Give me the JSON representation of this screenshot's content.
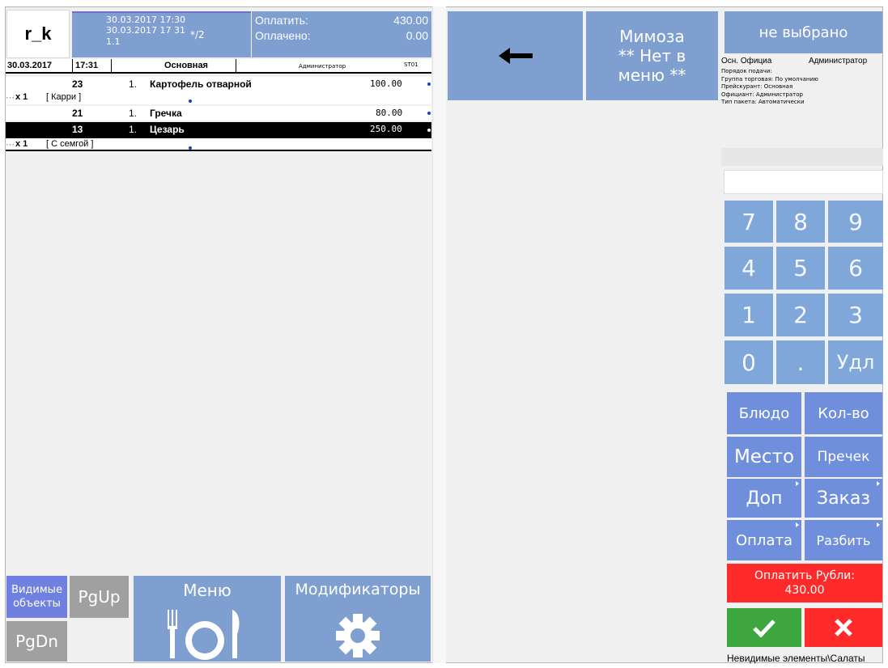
{
  "header": {
    "logo": "r_k",
    "datetime_open": "30.03.2017 17:30",
    "datetime_now": "30.03.2017 17 31",
    "table_no": "1.1",
    "guests": "*/2",
    "pay_label": "Оплатить:",
    "pay_value": "430.00",
    "paid_label": "Оплачено:",
    "paid_value": "0.00"
  },
  "order": {
    "date": "30.03.2017",
    "time": "17:31",
    "menu": "Основная",
    "waiter": "Администратор",
    "station": "ST01",
    "items": [
      {
        "code": "23",
        "qty": "1.",
        "name": "Картофель отварной",
        "price": "100.00",
        "modifier_qty": "x 1",
        "modifier": "[ Карри ]"
      },
      {
        "code": "21",
        "qty": "1.",
        "name": "Гречка",
        "price": "80.00"
      },
      {
        "code": "13",
        "qty": "1.",
        "name": "Цезарь",
        "price": "250.00",
        "modifier_qty": "x 1",
        "modifier": "[ С семгой ]"
      }
    ]
  },
  "left_buttons": {
    "visible_objects": "Видимые объекты",
    "pgup": "PgUp",
    "pgdn": "PgDn",
    "menu": "Меню",
    "modifiers": "Модификаторы"
  },
  "top": {
    "back_icon": "arrow-left-icon",
    "category_line1": "Мимоза",
    "category_line2": "** Нет в",
    "category_line3": "меню **",
    "not_selected": "не выбрано"
  },
  "info": {
    "officer_short": "Осн. Официа",
    "admin": "Администратор",
    "lines": [
      "Порядок подачи:",
      "Группа торговая: По умолчанию",
      "Прейскурант: Основная",
      "Официант: Администратор",
      "Тип пакета: Автоматически"
    ]
  },
  "keypad": {
    "input_value": "",
    "keys": [
      "7",
      "8",
      "9",
      "4",
      "5",
      "6",
      "1",
      "2",
      "3",
      "0",
      ".",
      "Удл"
    ]
  },
  "actions": {
    "dish": "Блюдо",
    "qty": "Кол-во",
    "place": "Место",
    "precheck": "Пречек",
    "extra": "Доп",
    "order": "Заказ",
    "payment": "Оплата",
    "split": "Разбить",
    "pay_rub_line1": "Оплатить Рубли:",
    "pay_rub_line2": "430.00",
    "ok_icon": "checkmark-icon",
    "cancel_icon": "close-icon"
  },
  "status": {
    "path": "Невидимые элементы\\Салаты"
  },
  "colors": {
    "button_blue": "#7f9fd0",
    "pay_red": "#ff2a2a",
    "ok_green": "#3ea63e"
  }
}
